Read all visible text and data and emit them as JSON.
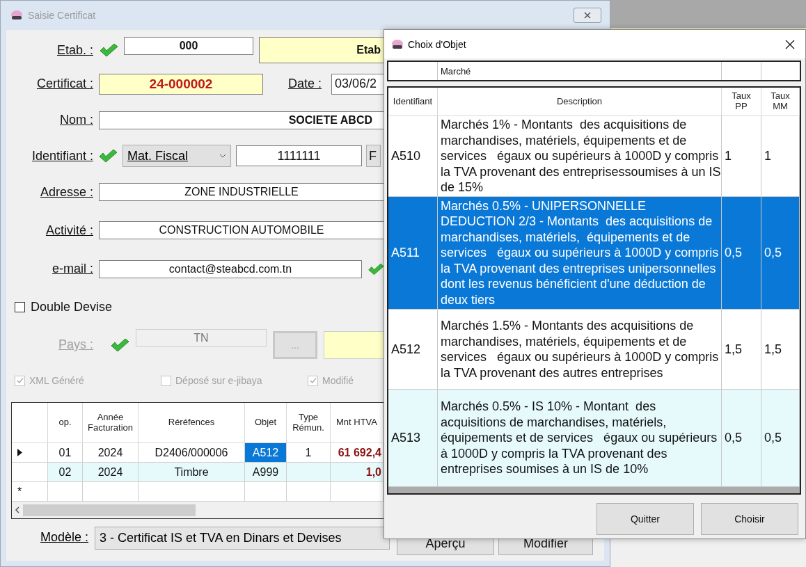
{
  "main_window": {
    "title": "Saisie Certificat",
    "etab": {
      "label": "Etab. :",
      "valid": true,
      "code": "000",
      "name": "Etab"
    },
    "certificat": {
      "label": "Certificat :",
      "value": "24-000002",
      "date_label": "Date :",
      "date": "03/06/2"
    },
    "nom": {
      "label": "Nom :",
      "value": "SOCIETE ABCD"
    },
    "identifiant": {
      "label": "Identifiant :",
      "valid": true,
      "type": "Mat. Fiscal",
      "value": "1111111",
      "button": "F"
    },
    "adresse": {
      "label": "Adresse :",
      "value": "ZONE INDUSTRIELLE"
    },
    "activite": {
      "label": "Activité :",
      "value": "CONSTRUCTION AUTOMOBILE"
    },
    "email": {
      "label": "e-mail :",
      "value": "contact@steabcd.com.tn",
      "valid": true
    },
    "double_devise": {
      "label": "Double Devise",
      "checked": false
    },
    "pays": {
      "label": "Pays :",
      "disabled": true,
      "valid": true,
      "value": "TN",
      "button": "..."
    },
    "flags": [
      {
        "label": "XML Généré",
        "checked": true,
        "disabled": true
      },
      {
        "label": "Déposé sur e-jibaya",
        "checked": false,
        "disabled": true
      },
      {
        "label": "Modifié",
        "checked": true,
        "disabled": true
      }
    ],
    "grid": {
      "columns": [
        "op.",
        "Année Facturation",
        "Réréfences",
        "Objet",
        "Type Rémun.",
        "Mnt HTVA"
      ],
      "rows": [
        {
          "current": true,
          "cells": [
            {
              "text": "01",
              "selected": false
            },
            {
              "text": "2024",
              "selected": false
            },
            {
              "text": "D2406/000006",
              "selected": false
            },
            {
              "text": "A512",
              "selected": true
            },
            {
              "text": "1",
              "selected": false
            },
            {
              "text": "61 692,4",
              "selected": false
            }
          ]
        },
        {
          "current": false,
          "cells": [
            {
              "text": "02",
              "selected": false
            },
            {
              "text": "2024",
              "selected": false
            },
            {
              "text": "Timbre",
              "selected": false
            },
            {
              "text": "A999",
              "selected": false
            },
            {
              "text": "",
              "selected": false
            },
            {
              "text": "1,0",
              "selected": false
            }
          ]
        }
      ],
      "new_row_marker": "*"
    },
    "modele": {
      "label": "Modèle :",
      "value": "3 - Certificat IS et TVA en Dinars et Devises"
    },
    "buttons": [
      "Aperçu",
      "Modifier"
    ]
  },
  "dialog": {
    "title": "Choix d'Objet",
    "filter": "Marché",
    "columns": [
      "Identifiant",
      "Description",
      "Taux PP",
      "Taux MM"
    ],
    "rows": [
      {
        "id": "A510",
        "description": "Marchés 1% - Montants  des acquisitions de marchandises, matériels, équipements et de services   égaux ou supérieurs à 1000D y compris la TVA provenant des entreprisessoumises à un IS de 15%",
        "taux_pp": "1",
        "taux_mm": "1",
        "selected": false
      },
      {
        "id": "A511",
        "description": "Marchés 0.5% - UNIPERSONNELLE DEDUCTION 2/3 - Montants  des acquisitions de marchandises, matériels,  équipements et de services   égaux ou supérieurs à 1000D y compris la TVA provenant des entreprises unipersonnelles dont les revenus bénéficient d'une déduction de deux tiers",
        "taux_pp": "0,5",
        "taux_mm": "0,5",
        "selected": true
      },
      {
        "id": "A512",
        "description": "Marchés 1.5% - Montants des acquisitions de marchandises, matériels, équipements et de services   égaux ou supérieurs à 1000D y compris la TVA provenant des autres entreprises",
        "taux_pp": "1,5",
        "taux_mm": "1,5",
        "selected": false
      },
      {
        "id": "A513",
        "description": "Marchés 0.5% - IS 10% - Montant  des acquisitions de marchandises, matériels, équipements et de services   égaux ou supérieurs à 1000D y compris la TVA provenant des entreprises soumises à un IS de 10%",
        "taux_pp": "0,5",
        "taux_mm": "0,5",
        "selected": false
      }
    ],
    "buttons": [
      "Quitter",
      "Choisir"
    ]
  }
}
